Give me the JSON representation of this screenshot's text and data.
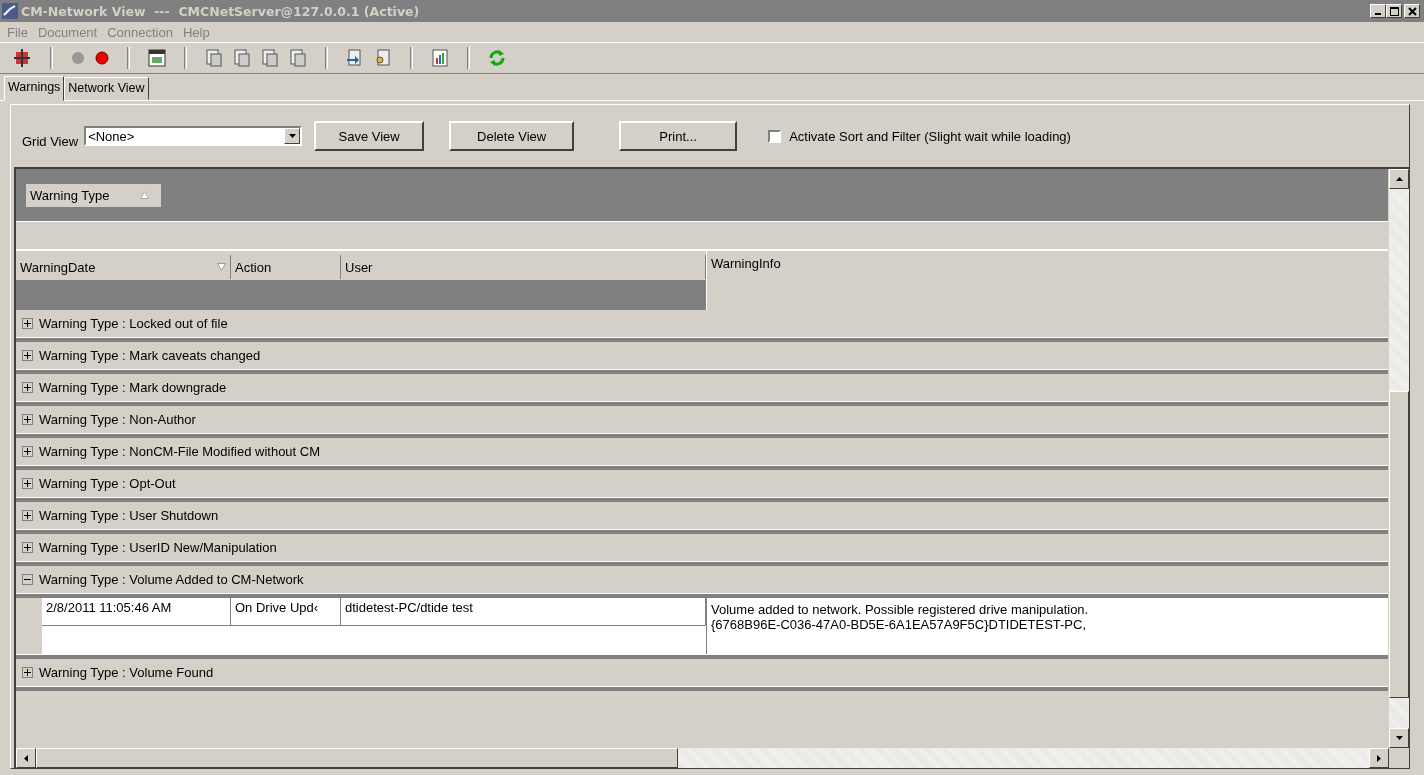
{
  "window": {
    "title": "CM-Network View  ---  CMCNetServer@127.0.0.1 (Active)"
  },
  "menu": [
    "File",
    "Document",
    "Connection",
    "Help"
  ],
  "tabs": [
    {
      "label": "Warnings",
      "selected": true
    },
    {
      "label": "Network View",
      "selected": false
    }
  ],
  "grid_view": {
    "label": "Grid View",
    "value": "<None>"
  },
  "buttons": [
    "Save View",
    "Delete View",
    "Print..."
  ],
  "sort_filter": {
    "label": "Activate Sort and Filter (Slight wait while loading)",
    "checked": false
  },
  "group_by": {
    "label": "Warning Type"
  },
  "columns": [
    "WarningDate",
    "Action",
    "User",
    "WarningInfo"
  ],
  "groups": [
    {
      "label": "Warning Type : Locked out of file",
      "expanded": false
    },
    {
      "label": "Warning Type : Mark caveats changed",
      "expanded": false
    },
    {
      "label": "Warning Type : Mark downgrade",
      "expanded": false
    },
    {
      "label": "Warning Type : Non-Author",
      "expanded": false
    },
    {
      "label": "Warning Type : NonCM-File Modified without CM",
      "expanded": false
    },
    {
      "label": "Warning Type : Opt-Out",
      "expanded": false
    },
    {
      "label": "Warning Type : User Shutdown",
      "expanded": false
    },
    {
      "label": "Warning Type : UserID New/Manipulation",
      "expanded": false
    },
    {
      "label": "Warning Type : Volume Added to CM-Network",
      "expanded": true,
      "rows": [
        {
          "date": "2/8/2011 11:05:46 AM",
          "action": "On Drive Upd‹",
          "user": "dtidetest-PC/dtide test",
          "info": [
            "Volume added to network. Possible registered drive manipulation.",
            "{6768B96E-C036-47A0-BD5E-6A1EA57A9F5C}DTIDETEST-PC,"
          ]
        }
      ]
    },
    {
      "label": "Warning Type : Volume Found",
      "expanded": false
    }
  ]
}
